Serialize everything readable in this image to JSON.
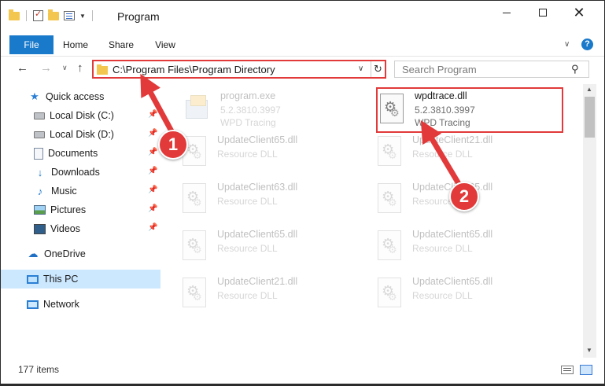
{
  "window": {
    "title": "Program",
    "minimize_icon": "minimize-icon",
    "maximize_icon": "maximize-icon",
    "close_icon": "close-icon"
  },
  "ribbon": {
    "tabs": [
      {
        "label": "File"
      },
      {
        "label": "Home"
      },
      {
        "label": "Share"
      },
      {
        "label": "View"
      }
    ],
    "help": "?"
  },
  "navigation": {
    "address": "C:\\Program Files\\Program Directory",
    "search_placeholder": "Search Program"
  },
  "sidebar": {
    "items": [
      {
        "label": "Quick access",
        "icon": "star-icon"
      },
      {
        "label": "Local Disk (C:)",
        "icon": "disk-icon",
        "pinned": true
      },
      {
        "label": "Local Disk (D:)",
        "icon": "disk-icon",
        "pinned": true
      },
      {
        "label": "Documents",
        "icon": "documents-icon",
        "pinned": true
      },
      {
        "label": "Downloads",
        "icon": "downloads-icon",
        "pinned": true
      },
      {
        "label": "Music",
        "icon": "music-icon",
        "pinned": true
      },
      {
        "label": "Pictures",
        "icon": "pictures-icon",
        "pinned": true
      },
      {
        "label": "Videos",
        "icon": "videos-icon",
        "pinned": true
      },
      {
        "label": "OneDrive",
        "icon": "onedrive-icon"
      },
      {
        "label": "This PC",
        "icon": "this-pc-icon",
        "selected": true
      },
      {
        "label": "Network",
        "icon": "network-icon"
      }
    ]
  },
  "files": [
    {
      "name": "program.exe",
      "meta1": "5.2.3810.3997",
      "meta2": "WPD Tracing",
      "type": "exe",
      "faded": true
    },
    {
      "name": "wpdtrace.dll",
      "meta1": "5.2.3810.3997",
      "meta2": "WPD Tracing",
      "type": "dll",
      "faded": false,
      "highlighted": true
    },
    {
      "name": "UpdateClient65.dll",
      "meta1": "Resource DLL",
      "meta2": "",
      "type": "dll",
      "faded": true
    },
    {
      "name": "UpdateClient21.dll",
      "meta1": "Resource DLL",
      "meta2": "",
      "type": "dll",
      "faded": true
    },
    {
      "name": "UpdateClient63.dll",
      "meta1": "Resource DLL",
      "meta2": "",
      "type": "dll",
      "faded": true
    },
    {
      "name": "UpdateClient65.dll",
      "meta1": "Resource DLL",
      "meta2": "",
      "type": "dll",
      "faded": true
    },
    {
      "name": "UpdateClient65.dll",
      "meta1": "Resource DLL",
      "meta2": "",
      "type": "dll",
      "faded": true
    },
    {
      "name": "UpdateClient65.dll",
      "meta1": "Resource DLL",
      "meta2": "",
      "type": "dll",
      "faded": true
    },
    {
      "name": "UpdateClient21.dll",
      "meta1": "Resource DLL",
      "meta2": "",
      "type": "dll",
      "faded": true
    },
    {
      "name": "UpdateClient65.dll",
      "meta1": "Resource DLL",
      "meta2": "",
      "type": "dll",
      "faded": true
    }
  ],
  "status": {
    "item_count": "177 items"
  },
  "annotations": {
    "step1": "1",
    "step2": "2",
    "highlight_color": "#e23a3a"
  },
  "colors": {
    "accent": "#1979ca",
    "selection": "#cce8ff"
  }
}
